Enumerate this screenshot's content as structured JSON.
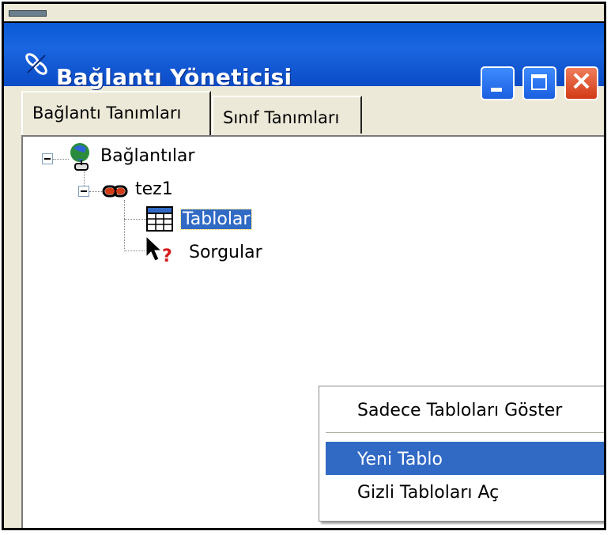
{
  "window": {
    "title": "Bağlantı Yöneticisi",
    "buttons": {
      "minimize": "minimize",
      "maximize": "maximize",
      "close": "close"
    },
    "title_color": "#0a5ad6"
  },
  "tabs": [
    {
      "label": "Bağlantı Tanımları",
      "active": true
    },
    {
      "label": "Sınıf Tanımları",
      "active": false
    }
  ],
  "tree": {
    "root": {
      "label": "Bağlantılar",
      "icon": "globe-network-icon",
      "expanded": true
    },
    "connection": {
      "label": "tez1",
      "icon": "chain-link-icon",
      "expanded": true
    },
    "children": [
      {
        "label": "Tablolar",
        "icon": "table-icon",
        "selected": true
      },
      {
        "label": "Sorgular",
        "icon": "query-help-icon",
        "selected": false
      }
    ]
  },
  "context_menu": {
    "items": [
      {
        "label": "Sadece Tabloları Göster"
      },
      {
        "label": "Yeni Tablo",
        "highlighted": true
      },
      {
        "label": "Gizli Tabloları Aç"
      }
    ]
  },
  "colors": {
    "selection": "#316ac5",
    "face": "#ece9d8",
    "close": "#d23a16"
  }
}
